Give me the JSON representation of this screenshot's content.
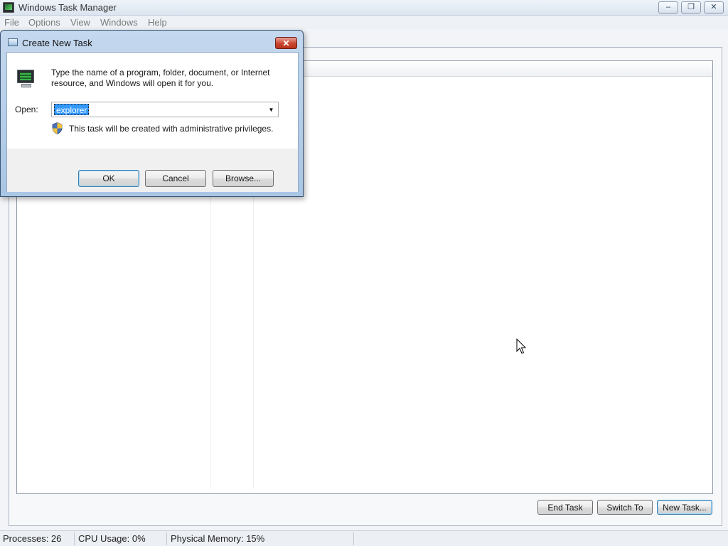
{
  "window": {
    "title": "Windows Task Manager",
    "minimize_glyph": "–",
    "restore_glyph": "❐",
    "close_glyph": "✕"
  },
  "menu": {
    "items": [
      "File",
      "Options",
      "View",
      "Windows",
      "Help"
    ]
  },
  "buttons": {
    "end_task": "End Task",
    "switch_to": "Switch To",
    "new_task": "New Task..."
  },
  "status": {
    "processes": "Processes: 26",
    "cpu": "CPU Usage: 0%",
    "memory": "Physical Memory: 15%"
  },
  "dialog": {
    "title": "Create New Task",
    "close_glyph": "✕",
    "description": "Type the name of a program, folder, document, or Internet resource, and Windows will open it for you.",
    "open_label": "Open:",
    "open_value": "explorer",
    "dropdown_glyph": "▼",
    "admin_note": "This task will be created with administrative privileges.",
    "ok_label": "OK",
    "cancel_label": "Cancel",
    "browse_label": "Browse..."
  },
  "icons": {
    "app": "task-manager-icon",
    "dialog": "run-window-icon",
    "run": "computer-monitor-icon",
    "shield": "uac-shield-icon",
    "cursor": "mouse-pointer-icon"
  },
  "colors": {
    "selection": "#3399ff",
    "dialog_frame": "#a9c6e4",
    "close_button": "#c9452f",
    "focus_border": "#3c7fb1"
  }
}
